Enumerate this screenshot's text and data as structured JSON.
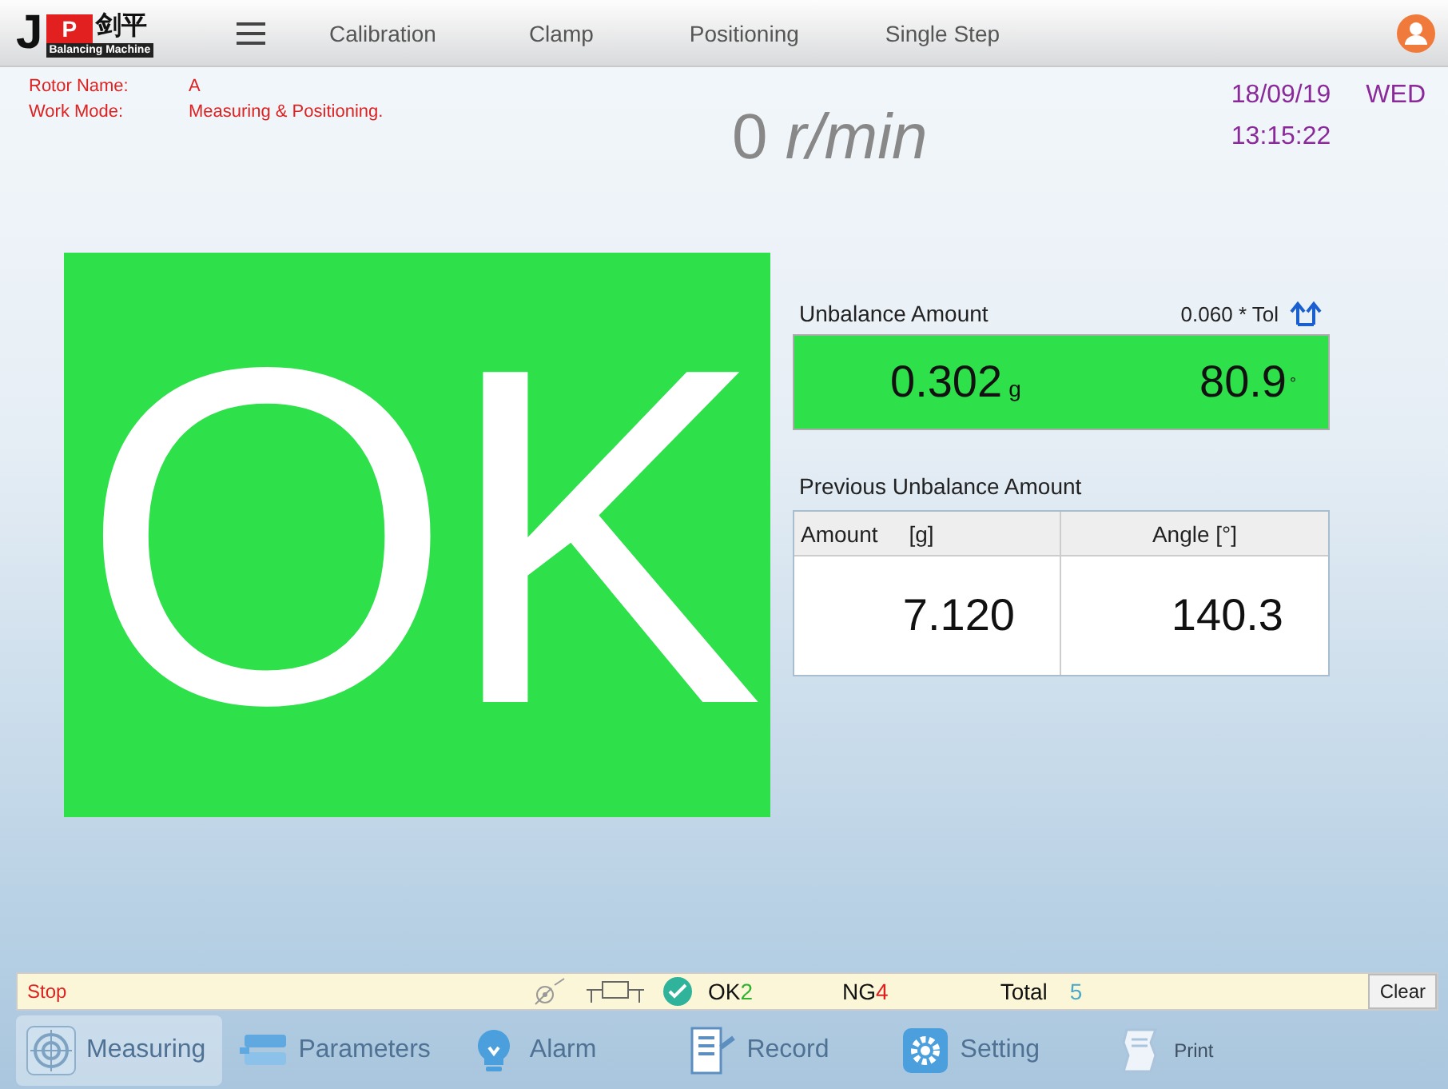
{
  "logo": {
    "mark_j": "J",
    "mark_p": "P",
    "chinese": "剑平",
    "subtitle": "Balancing Machine"
  },
  "menu": [
    {
      "label": "Calibration"
    },
    {
      "label": "Clamp"
    },
    {
      "label": "Positioning"
    },
    {
      "label": "Single Step"
    }
  ],
  "info": [
    {
      "label": "Rotor Name:",
      "value": "A"
    },
    {
      "label": "Work Mode:",
      "value": "Measuring & Positioning."
    }
  ],
  "speed": {
    "value": "0",
    "unit": "r/min"
  },
  "datetime": {
    "date": "18/09/19",
    "weekday": "WED",
    "time": "13:15:22"
  },
  "result": {
    "text": "OK",
    "color": "#2ee04a"
  },
  "unbalance": {
    "title": "Unbalance Amount",
    "tolerance": "0.060 * Tol",
    "amount": "0.302",
    "amount_unit": "g",
    "angle": "80.9",
    "angle_unit": "°",
    "color": "#2ee04a"
  },
  "previous": {
    "title": "Previous Unbalance Amount",
    "columns": [
      "Amount     [g]",
      "Angle [°]"
    ],
    "values": [
      "7.120",
      "140.3"
    ]
  },
  "status": {
    "state": "Stop",
    "ok_label": "OK",
    "ok_count": "2",
    "ng_label": "NG",
    "ng_count": "4",
    "total_label": "Total",
    "total_count": "5",
    "clear": "Clear"
  },
  "nav": [
    {
      "label": "Measuring",
      "kind": "target",
      "selected": true,
      "disabled": false
    },
    {
      "label": "Parameters",
      "kind": "params",
      "selected": false,
      "disabled": false
    },
    {
      "label": "Alarm",
      "kind": "bulb",
      "selected": false,
      "disabled": false
    },
    {
      "label": "Record",
      "kind": "record",
      "selected": false,
      "disabled": false
    },
    {
      "label": "Setting",
      "kind": "gear",
      "selected": false,
      "disabled": false
    },
    {
      "label": "Print",
      "kind": "print",
      "selected": false,
      "disabled": true
    }
  ]
}
